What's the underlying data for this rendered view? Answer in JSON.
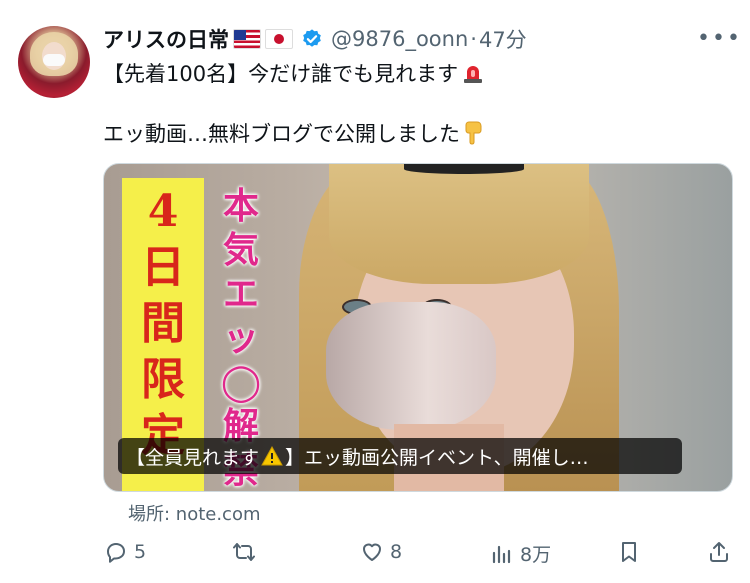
{
  "tweet": {
    "display_name": "アリスの日常",
    "flags": [
      "us-flag-icon",
      "jp-flag-icon"
    ],
    "verified_icon": "verified-badge-icon",
    "handle": "@9876_oonn",
    "separator": "·",
    "time_ago": "47分",
    "more_icon": "more-options-icon",
    "line1": "【先着100名】今だけ誰でも見れます",
    "line1_emoji": "siren-icon",
    "line2": "エッ動画…無料ブログで公開しました",
    "line2_emoji": "pointing-down-icon"
  },
  "card": {
    "vertical_left": "4日間限定",
    "vertical_right": "本気エッ◯解禁",
    "caption_prefix": "【全員見れます",
    "caption_warning_icon": "warning-icon",
    "caption_suffix": "】エッ動画公開イベント、開催し…",
    "source": "場所: note.com"
  },
  "actions": {
    "reply_count": "5",
    "retweet_count": "",
    "like_count": "8",
    "view_count": "8万",
    "icons": [
      "reply-icon",
      "retweet-icon",
      "like-icon",
      "views-icon",
      "bookmark-icon",
      "share-icon"
    ]
  },
  "colors": {
    "text": "#0f1419",
    "secondary": "#536471",
    "verified": "#1d9bf0",
    "card_yellow": "#f5ef4a",
    "card_red_text": "#d8261b",
    "card_pink_text": "#e0288c"
  }
}
